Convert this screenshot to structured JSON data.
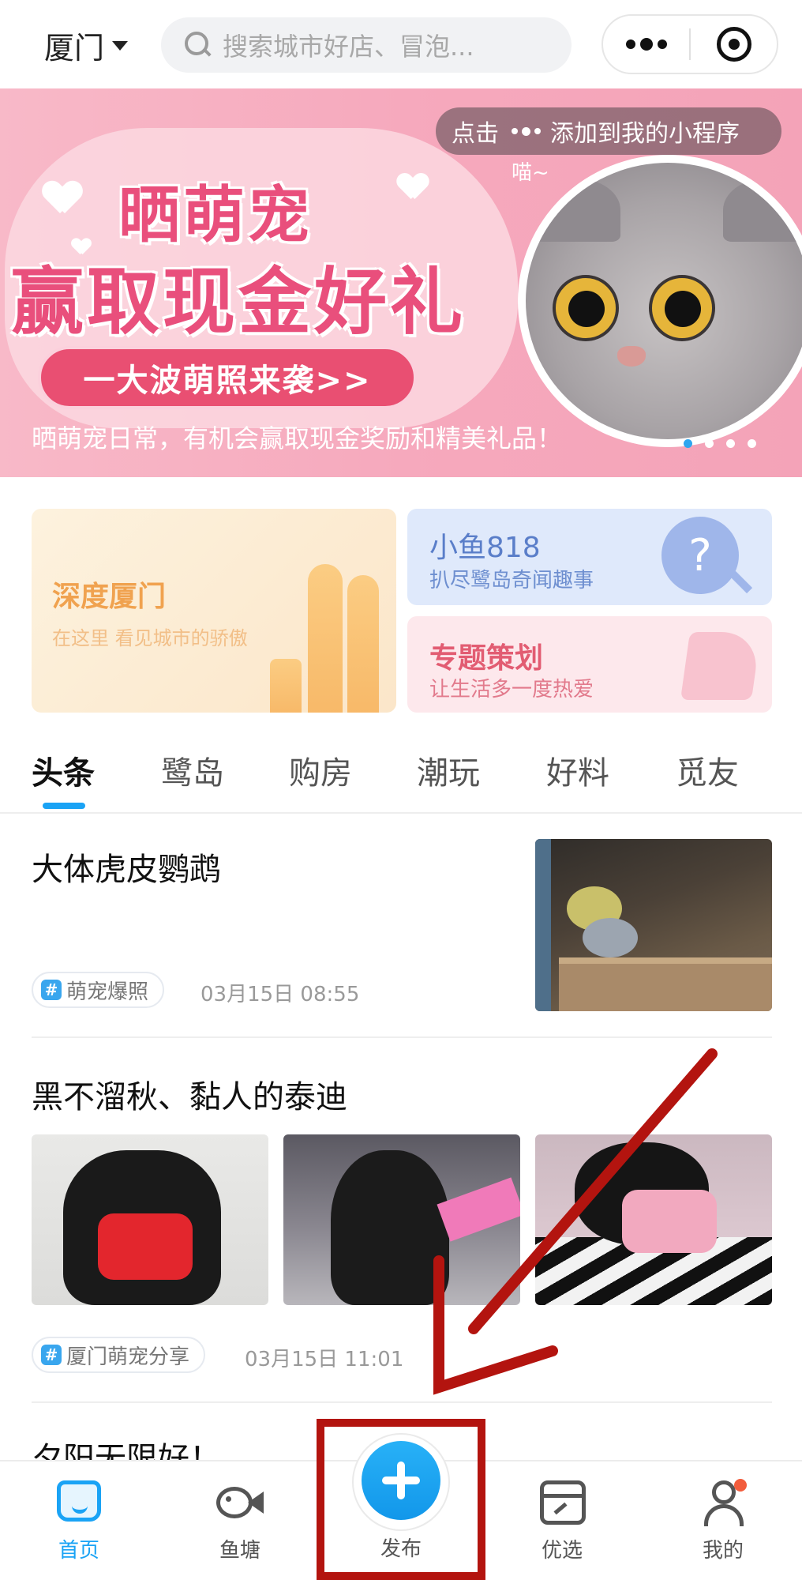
{
  "topbar": {
    "city": "厦门",
    "search_placeholder": "搜索城市好店、冒泡..."
  },
  "banner": {
    "tip_prefix": "点击",
    "tip_suffix": "添加到我的小程序",
    "meow": "喵~",
    "title_line1": "晒萌宠",
    "title_line2": "赢取现金好礼",
    "button": "一大波萌照来袭>>",
    "caption": "晒萌宠日常，有机会赢取现金奖励和精美礼品！",
    "page_count": 4,
    "active_page": 1
  },
  "cards": {
    "deep": {
      "title": "深度厦门",
      "subtitle": "在这里 看见城市的骄傲"
    },
    "fish": {
      "title": "小鱼818",
      "subtitle": "扒尽鹭岛奇闻趣事"
    },
    "topic": {
      "title": "专题策划",
      "subtitle": "让生活多一度热爱"
    }
  },
  "tabs": [
    "头条",
    "鹭岛",
    "购房",
    "潮玩",
    "好料",
    "觅友"
  ],
  "feed": [
    {
      "title": "大体虎皮鹦鹉",
      "tag": "萌宠爆照",
      "time": "03月15日 08:55"
    },
    {
      "title": "黑不溜秋、黏人的泰迪",
      "tag": "厦门萌宠分享",
      "time": "03月15日 11:01"
    },
    {
      "title": "夕阳无限好！"
    }
  ],
  "nav": {
    "home": "首页",
    "pond": "鱼塘",
    "publish": "发布",
    "selected": "优选",
    "mine": "我的"
  },
  "colors": {
    "accent": "#1aa3f5",
    "annotation": "#b3140f"
  }
}
